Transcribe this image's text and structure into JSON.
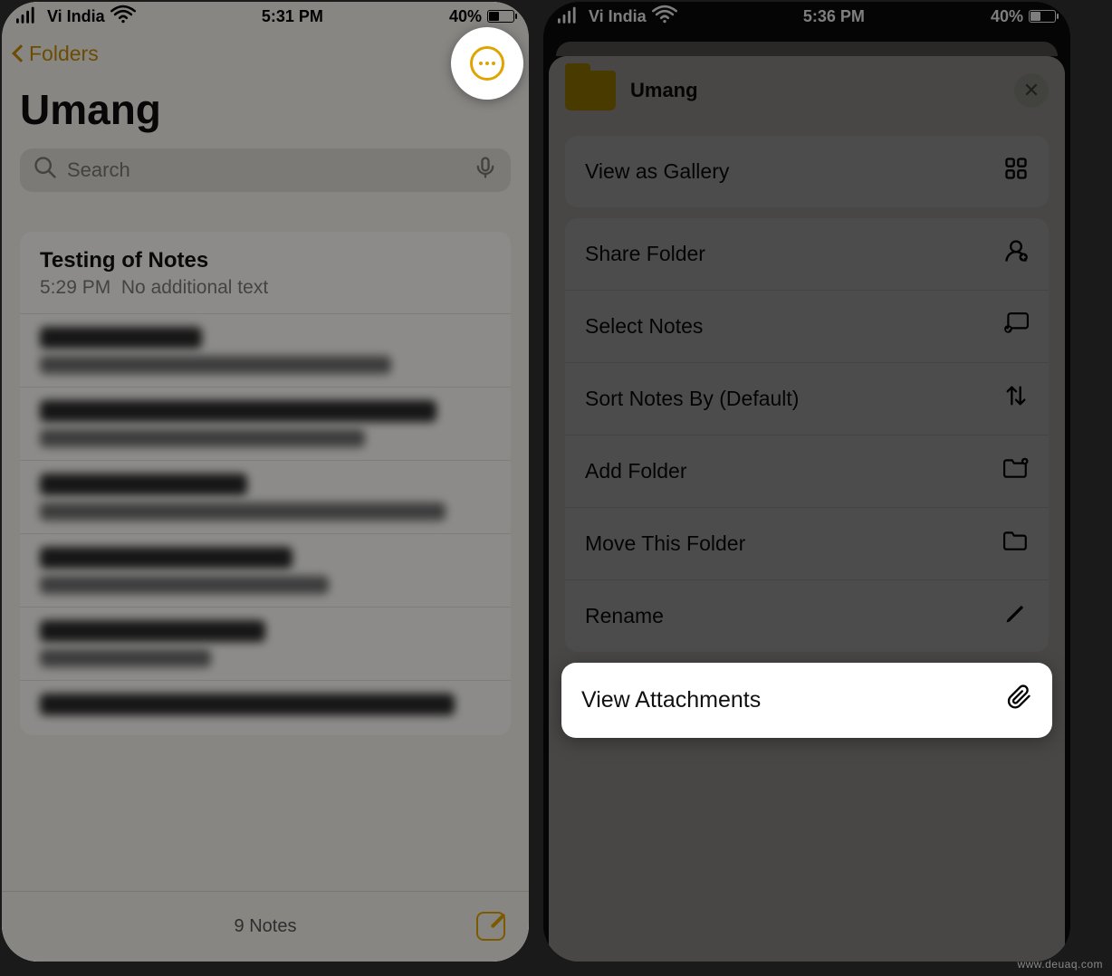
{
  "left": {
    "status": {
      "carrier": "Vi India",
      "time": "5:31 PM",
      "battery": "40%"
    },
    "back_label": "Folders",
    "title": "Umang",
    "search_placeholder": "Search",
    "notes": [
      {
        "title": "Testing of Notes",
        "time": "5:29 PM",
        "preview": "No additional text"
      }
    ],
    "footer_count": "9 Notes"
  },
  "right": {
    "status": {
      "carrier": "Vi India",
      "time": "5:36 PM",
      "battery": "40%"
    },
    "sheet_title": "Umang",
    "group1": {
      "view_gallery": "View as Gallery"
    },
    "group2": {
      "share_folder": "Share Folder",
      "select_notes": "Select Notes",
      "sort_notes": "Sort Notes By (Default)",
      "add_folder": "Add Folder",
      "move_folder": "Move This Folder",
      "rename": "Rename"
    },
    "highlight": {
      "view_attachments": "View Attachments"
    }
  },
  "watermark": "www.deuaq.com"
}
